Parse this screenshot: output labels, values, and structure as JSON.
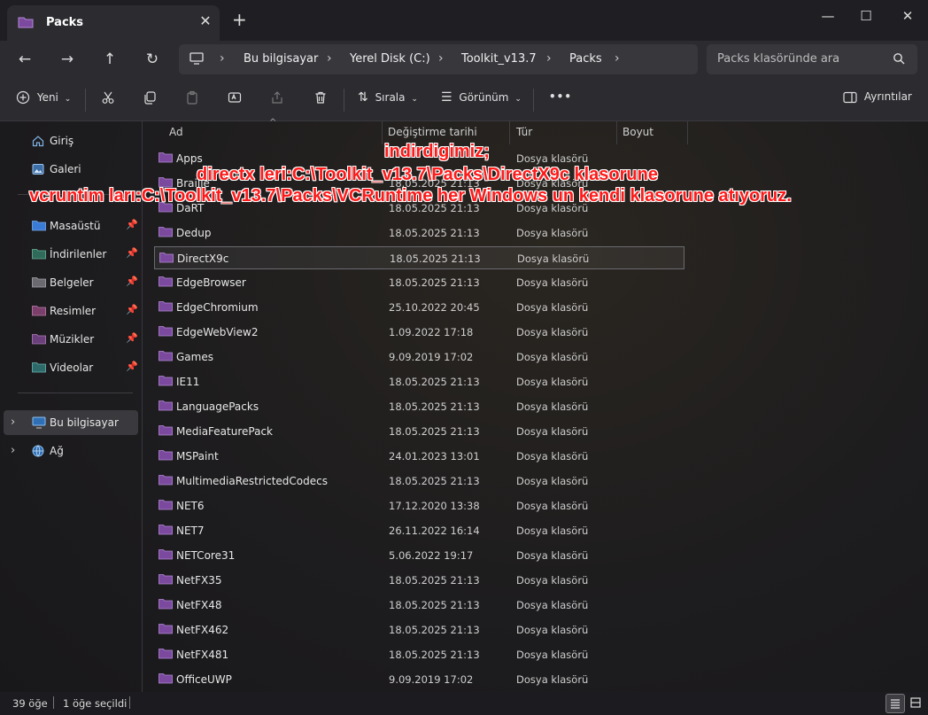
{
  "tab": {
    "title": "Packs"
  },
  "window_controls": {
    "minimize": "—",
    "maximize": "☐",
    "close": "✕"
  },
  "address": {
    "crumbs": [
      "Bu bilgisayar",
      "Yerel Disk (C:)",
      "Toolkit_v13.7",
      "Packs"
    ]
  },
  "search": {
    "placeholder": "Packs klasöründe ara"
  },
  "toolbar": {
    "new_label": "Yeni",
    "sort_label": "Sırala",
    "view_label": "Görünüm",
    "more_label": "•••",
    "details_label": "Ayrıntılar"
  },
  "sidebar": {
    "top": [
      {
        "label": "Giriş",
        "icon": "home-icon"
      },
      {
        "label": "Galeri",
        "icon": "gallery-icon"
      }
    ],
    "pinned": [
      {
        "label": "Masaüstü",
        "color": "#3a7bd5"
      },
      {
        "label": "İndirilenler",
        "color": "#2f8f5a"
      },
      {
        "label": "Belgeler",
        "color": "#8a8a8a"
      },
      {
        "label": "Resimler",
        "color": "#2f7fbf"
      },
      {
        "label": "Müzikler",
        "color": "#c85a2a"
      },
      {
        "label": "Videolar",
        "color": "#7a3fb0"
      }
    ],
    "bottom": [
      {
        "label": "Bu bilgisayar",
        "selected": true
      },
      {
        "label": "Ağ",
        "selected": false
      }
    ]
  },
  "columns": {
    "name": "Ad",
    "date": "Değiştirme tarihi",
    "type": "Tür",
    "size": "Boyut"
  },
  "files": [
    {
      "name": "Apps",
      "date": "",
      "type": "Dosya klasörü"
    },
    {
      "name": "Braille",
      "date": "18.05.2025 21:13",
      "type": "Dosya klasörü"
    },
    {
      "name": "DaRT",
      "date": "18.05.2025 21:13",
      "type": "Dosya klasörü"
    },
    {
      "name": "Dedup",
      "date": "18.05.2025 21:13",
      "type": "Dosya klasörü"
    },
    {
      "name": "DirectX9c",
      "date": "18.05.2025 21:13",
      "type": "Dosya klasörü",
      "selected": true
    },
    {
      "name": "EdgeBrowser",
      "date": "18.05.2025 21:13",
      "type": "Dosya klasörü"
    },
    {
      "name": "EdgeChromium",
      "date": "25.10.2022 20:45",
      "type": "Dosya klasörü"
    },
    {
      "name": "EdgeWebView2",
      "date": "1.09.2022 17:18",
      "type": "Dosya klasörü"
    },
    {
      "name": "Games",
      "date": "9.09.2019 17:02",
      "type": "Dosya klasörü"
    },
    {
      "name": "IE11",
      "date": "18.05.2025 21:13",
      "type": "Dosya klasörü"
    },
    {
      "name": "LanguagePacks",
      "date": "18.05.2025 21:13",
      "type": "Dosya klasörü"
    },
    {
      "name": "MediaFeaturePack",
      "date": "18.05.2025 21:13",
      "type": "Dosya klasörü"
    },
    {
      "name": "MSPaint",
      "date": "24.01.2023 13:01",
      "type": "Dosya klasörü"
    },
    {
      "name": "MultimediaRestrictedCodecs",
      "date": "18.05.2025 21:13",
      "type": "Dosya klasörü"
    },
    {
      "name": "NET6",
      "date": "17.12.2020 13:38",
      "type": "Dosya klasörü"
    },
    {
      "name": "NET7",
      "date": "26.11.2022 16:14",
      "type": "Dosya klasörü"
    },
    {
      "name": "NETCore31",
      "date": "5.06.2022 19:17",
      "type": "Dosya klasörü"
    },
    {
      "name": "NetFX35",
      "date": "18.05.2025 21:13",
      "type": "Dosya klasörü"
    },
    {
      "name": "NetFX48",
      "date": "18.05.2025 21:13",
      "type": "Dosya klasörü"
    },
    {
      "name": "NetFX462",
      "date": "18.05.2025 21:13",
      "type": "Dosya klasörü"
    },
    {
      "name": "NetFX481",
      "date": "18.05.2025 21:13",
      "type": "Dosya klasörü"
    },
    {
      "name": "OfficeUWP",
      "date": "9.09.2019 17:02",
      "type": "Dosya klasörü"
    }
  ],
  "overlay": {
    "line1": "indirdigimiz;",
    "line2": "directx leri:C:\\Toolkit_v13.7\\Packs\\DirectX9c klasorune",
    "line3": "vcruntim ları:C:\\Toolkit_v13.7\\Packs\\VCRuntime her Windows un kendi klasorune atıyoruz."
  },
  "status": {
    "count": "39 öğe",
    "selected": "1 öğe seçildi"
  },
  "colors": {
    "folder": "#7b4a9e",
    "overlay_text": "#ff1a1a"
  }
}
